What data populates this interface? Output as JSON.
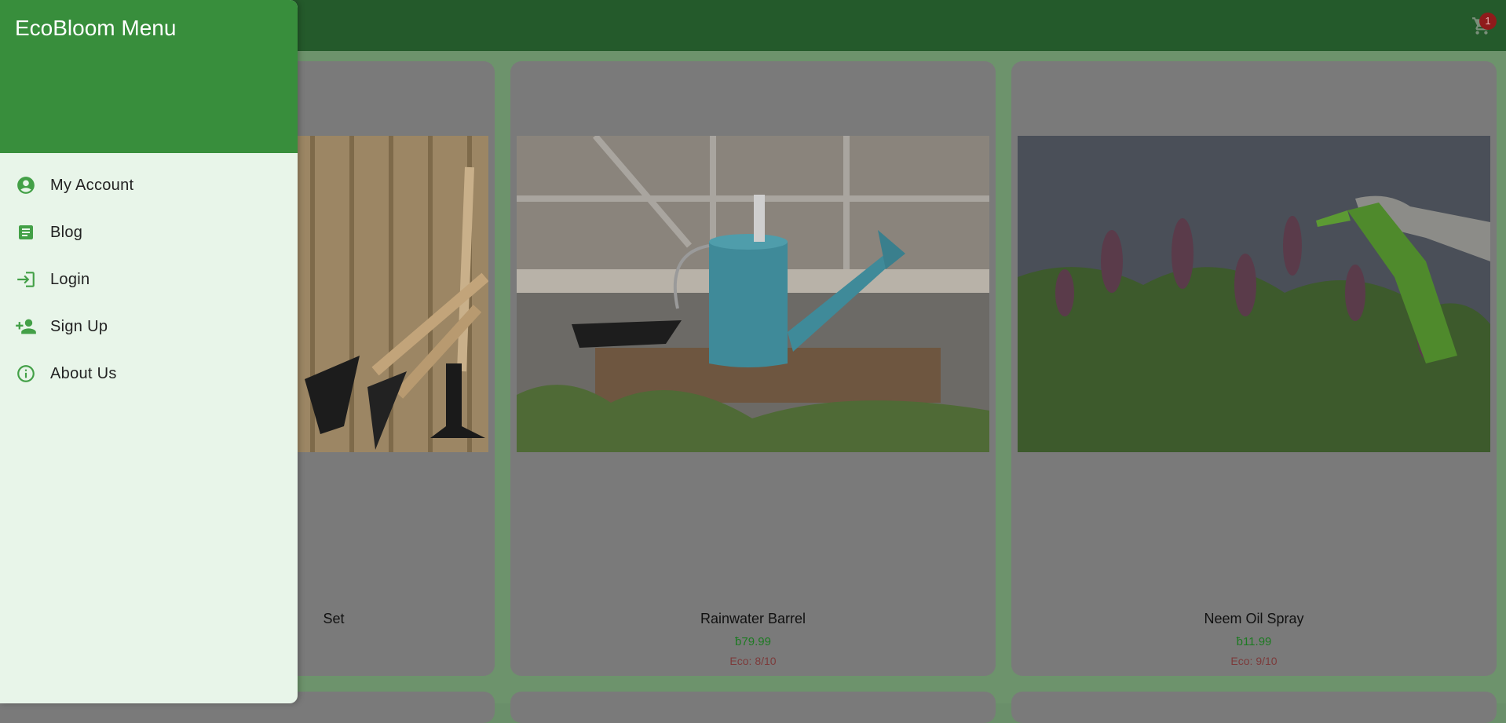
{
  "appbar": {
    "cart_count": "1",
    "colors": {
      "bar": "#245a2b",
      "badge": "#8f1b1b"
    }
  },
  "drawer": {
    "title": "EcoBloom Menu",
    "items": [
      {
        "label": "My Account",
        "icon": "account-circle-icon"
      },
      {
        "label": "Blog",
        "icon": "article-icon"
      },
      {
        "label": "Login",
        "icon": "login-icon"
      },
      {
        "label": "Sign Up",
        "icon": "person-add-icon"
      },
      {
        "label": "About Us",
        "icon": "info-icon"
      }
    ],
    "colors": {
      "header": "#388e3c",
      "background": "#e8f5e9",
      "icon": "#43a047"
    }
  },
  "products": [
    {
      "name_fragment": "Set"
    },
    {
      "name": "Rainwater Barrel",
      "price": "ƀ79.99",
      "eco": "Eco: 8/10"
    },
    {
      "name": "Neem Oil Spray",
      "price": "ƀ11.99",
      "eco": "Eco: 9/10"
    }
  ]
}
